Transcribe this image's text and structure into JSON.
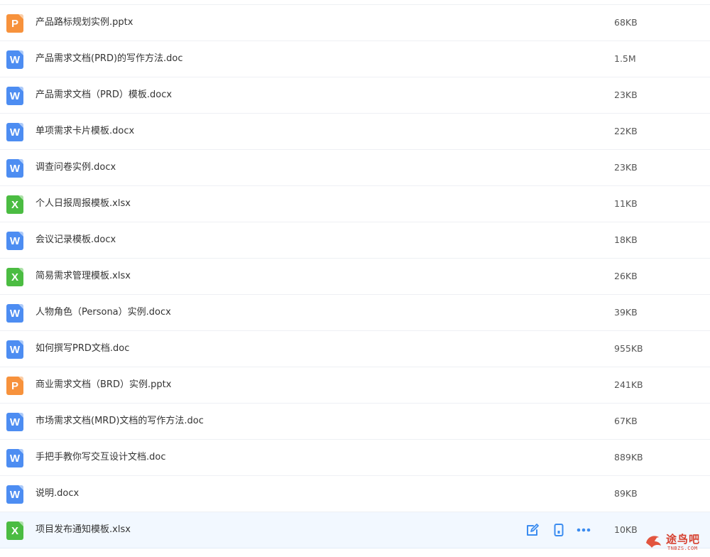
{
  "files": [
    {
      "type": "P",
      "icon": "ppt-file-icon",
      "name": "产品路标规划实例.pptx",
      "size": "68KB"
    },
    {
      "type": "W",
      "icon": "word-file-icon",
      "name": "产品需求文档(PRD)的写作方法.doc",
      "size": "1.5M"
    },
    {
      "type": "W",
      "icon": "word-file-icon",
      "name": "产品需求文档（PRD）模板.docx",
      "size": "23KB"
    },
    {
      "type": "W",
      "icon": "word-file-icon",
      "name": "单项需求卡片模板.docx",
      "size": "22KB"
    },
    {
      "type": "W",
      "icon": "word-file-icon",
      "name": "调查问卷实例.docx",
      "size": "23KB"
    },
    {
      "type": "X",
      "icon": "excel-file-icon",
      "name": "个人日报周报模板.xlsx",
      "size": "11KB"
    },
    {
      "type": "W",
      "icon": "word-file-icon",
      "name": "会议记录模板.docx",
      "size": "18KB"
    },
    {
      "type": "X",
      "icon": "excel-file-icon",
      "name": "简易需求管理模板.xlsx",
      "size": "26KB"
    },
    {
      "type": "W",
      "icon": "word-file-icon",
      "name": "人物角色（Persona）实例.docx",
      "size": "39KB"
    },
    {
      "type": "W",
      "icon": "word-file-icon",
      "name": "如何撰写PRD文档.doc",
      "size": "955KB"
    },
    {
      "type": "P",
      "icon": "ppt-file-icon",
      "name": "商业需求文档（BRD）实例.pptx",
      "size": "241KB"
    },
    {
      "type": "W",
      "icon": "word-file-icon",
      "name": "市场需求文档(MRD)文档的写作方法.doc",
      "size": "67KB"
    },
    {
      "type": "W",
      "icon": "word-file-icon",
      "name": "手把手教你写交互设计文档.doc",
      "size": "889KB"
    },
    {
      "type": "W",
      "icon": "word-file-icon",
      "name": "说明.docx",
      "size": "89KB"
    },
    {
      "type": "X",
      "icon": "excel-file-icon",
      "name": "项目发布通知模板.xlsx",
      "size": "10KB"
    }
  ],
  "hover_actions": [
    "edit-icon",
    "mobile-icon",
    "more-icon"
  ],
  "watermark": {
    "text": "途鸟吧",
    "sub": "TNBZS.COM"
  },
  "colors": {
    "word": "#4d8df2",
    "ppt": "#f7923c",
    "excel": "#4bbc42",
    "action": "#3b8cf0",
    "hover_row": "#f2f8ff"
  }
}
